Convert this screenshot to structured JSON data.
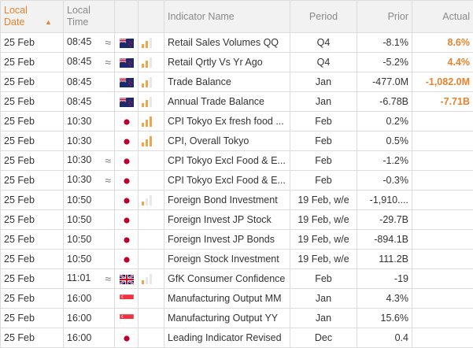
{
  "header": {
    "local_date": "Local Date",
    "local_time": "Local Time",
    "indicator": "Indicator Name",
    "period": "Period",
    "prior": "Prior",
    "actual": "Actual"
  },
  "colors": {
    "accent": "#e8822c",
    "importance_on": "#f0a44b",
    "importance_off": "#e8e8e8"
  },
  "rows": [
    {
      "date": "25 Feb",
      "time": "08:45",
      "wave": "≈",
      "flag": "nz",
      "importance": 2,
      "name": "Retail Sales Volumes QQ",
      "period": "Q4",
      "prior": "-8.1%",
      "actual": "8.6%"
    },
    {
      "date": "25 Feb",
      "time": "08:45",
      "wave": "≈",
      "flag": "nz",
      "importance": 2,
      "name": "Retail Qrtly Vs Yr Ago",
      "period": "Q4",
      "prior": "-5.2%",
      "actual": "4.4%"
    },
    {
      "date": "25 Feb",
      "time": "08:45",
      "wave": "",
      "flag": "nz",
      "importance": 2,
      "name": "Trade Balance",
      "period": "Jan",
      "prior": "-477.0M",
      "actual": "-1,082.0M"
    },
    {
      "date": "25 Feb",
      "time": "08:45",
      "wave": "",
      "flag": "nz",
      "importance": 2,
      "name": "Annual Trade Balance",
      "period": "Jan",
      "prior": "-6.78B",
      "actual": "-7.71B"
    },
    {
      "date": "25 Feb",
      "time": "10:30",
      "wave": "",
      "flag": "jp",
      "importance": 3,
      "name": "CPI Tokyo Ex fresh food ...",
      "period": "Feb",
      "prior": "0.2%",
      "actual": ""
    },
    {
      "date": "25 Feb",
      "time": "10:30",
      "wave": "",
      "flag": "jp",
      "importance": 3,
      "name": "CPI, Overall Tokyo",
      "period": "Feb",
      "prior": "0.5%",
      "actual": ""
    },
    {
      "date": "25 Feb",
      "time": "10:30",
      "wave": "≈",
      "flag": "jp",
      "importance": 0,
      "name": "CPI Tokyo Excl Food & E...",
      "period": "Feb",
      "prior": "-1.2%",
      "actual": ""
    },
    {
      "date": "25 Feb",
      "time": "10:30",
      "wave": "≈",
      "flag": "jp",
      "importance": 0,
      "name": "CPI Tokyo Excl Food & E...",
      "period": "Feb",
      "prior": "-0.3%",
      "actual": ""
    },
    {
      "date": "25 Feb",
      "time": "10:50",
      "wave": "",
      "flag": "jp",
      "importance": 1,
      "name": "Foreign Bond Investment",
      "period": "19 Feb, w/e",
      "prior": "-1,910....",
      "actual": ""
    },
    {
      "date": "25 Feb",
      "time": "10:50",
      "wave": "",
      "flag": "jp",
      "importance": 0,
      "name": "Foreign Invest JP Stock",
      "period": "19 Feb, w/e",
      "prior": "-29.7B",
      "actual": ""
    },
    {
      "date": "25 Feb",
      "time": "10:50",
      "wave": "",
      "flag": "jp",
      "importance": 0,
      "name": "Foreign Invest JP Bonds",
      "period": "19 Feb, w/e",
      "prior": "-894.1B",
      "actual": ""
    },
    {
      "date": "25 Feb",
      "time": "10:50",
      "wave": "",
      "flag": "jp",
      "importance": 0,
      "name": "Foreign Stock Investment",
      "period": "19 Feb, w/e",
      "prior": "111.2B",
      "actual": ""
    },
    {
      "date": "25 Feb",
      "time": "11:01",
      "wave": "≈",
      "flag": "gb",
      "importance": 1,
      "name": "GfK Consumer Confidence",
      "period": "Feb",
      "prior": "-19",
      "actual": ""
    },
    {
      "date": "25 Feb",
      "time": "16:00",
      "wave": "",
      "flag": "sg",
      "importance": 0,
      "name": "Manufacturing Output MM",
      "period": "Jan",
      "prior": "4.3%",
      "actual": ""
    },
    {
      "date": "25 Feb",
      "time": "16:00",
      "wave": "",
      "flag": "sg",
      "importance": 0,
      "name": "Manufacturing Output YY",
      "period": "Jan",
      "prior": "15.6%",
      "actual": ""
    },
    {
      "date": "25 Feb",
      "time": "16:00",
      "wave": "",
      "flag": "jp",
      "importance": 0,
      "name": "Leading Indicator Revised",
      "period": "Dec",
      "prior": "0.4",
      "actual": ""
    }
  ]
}
